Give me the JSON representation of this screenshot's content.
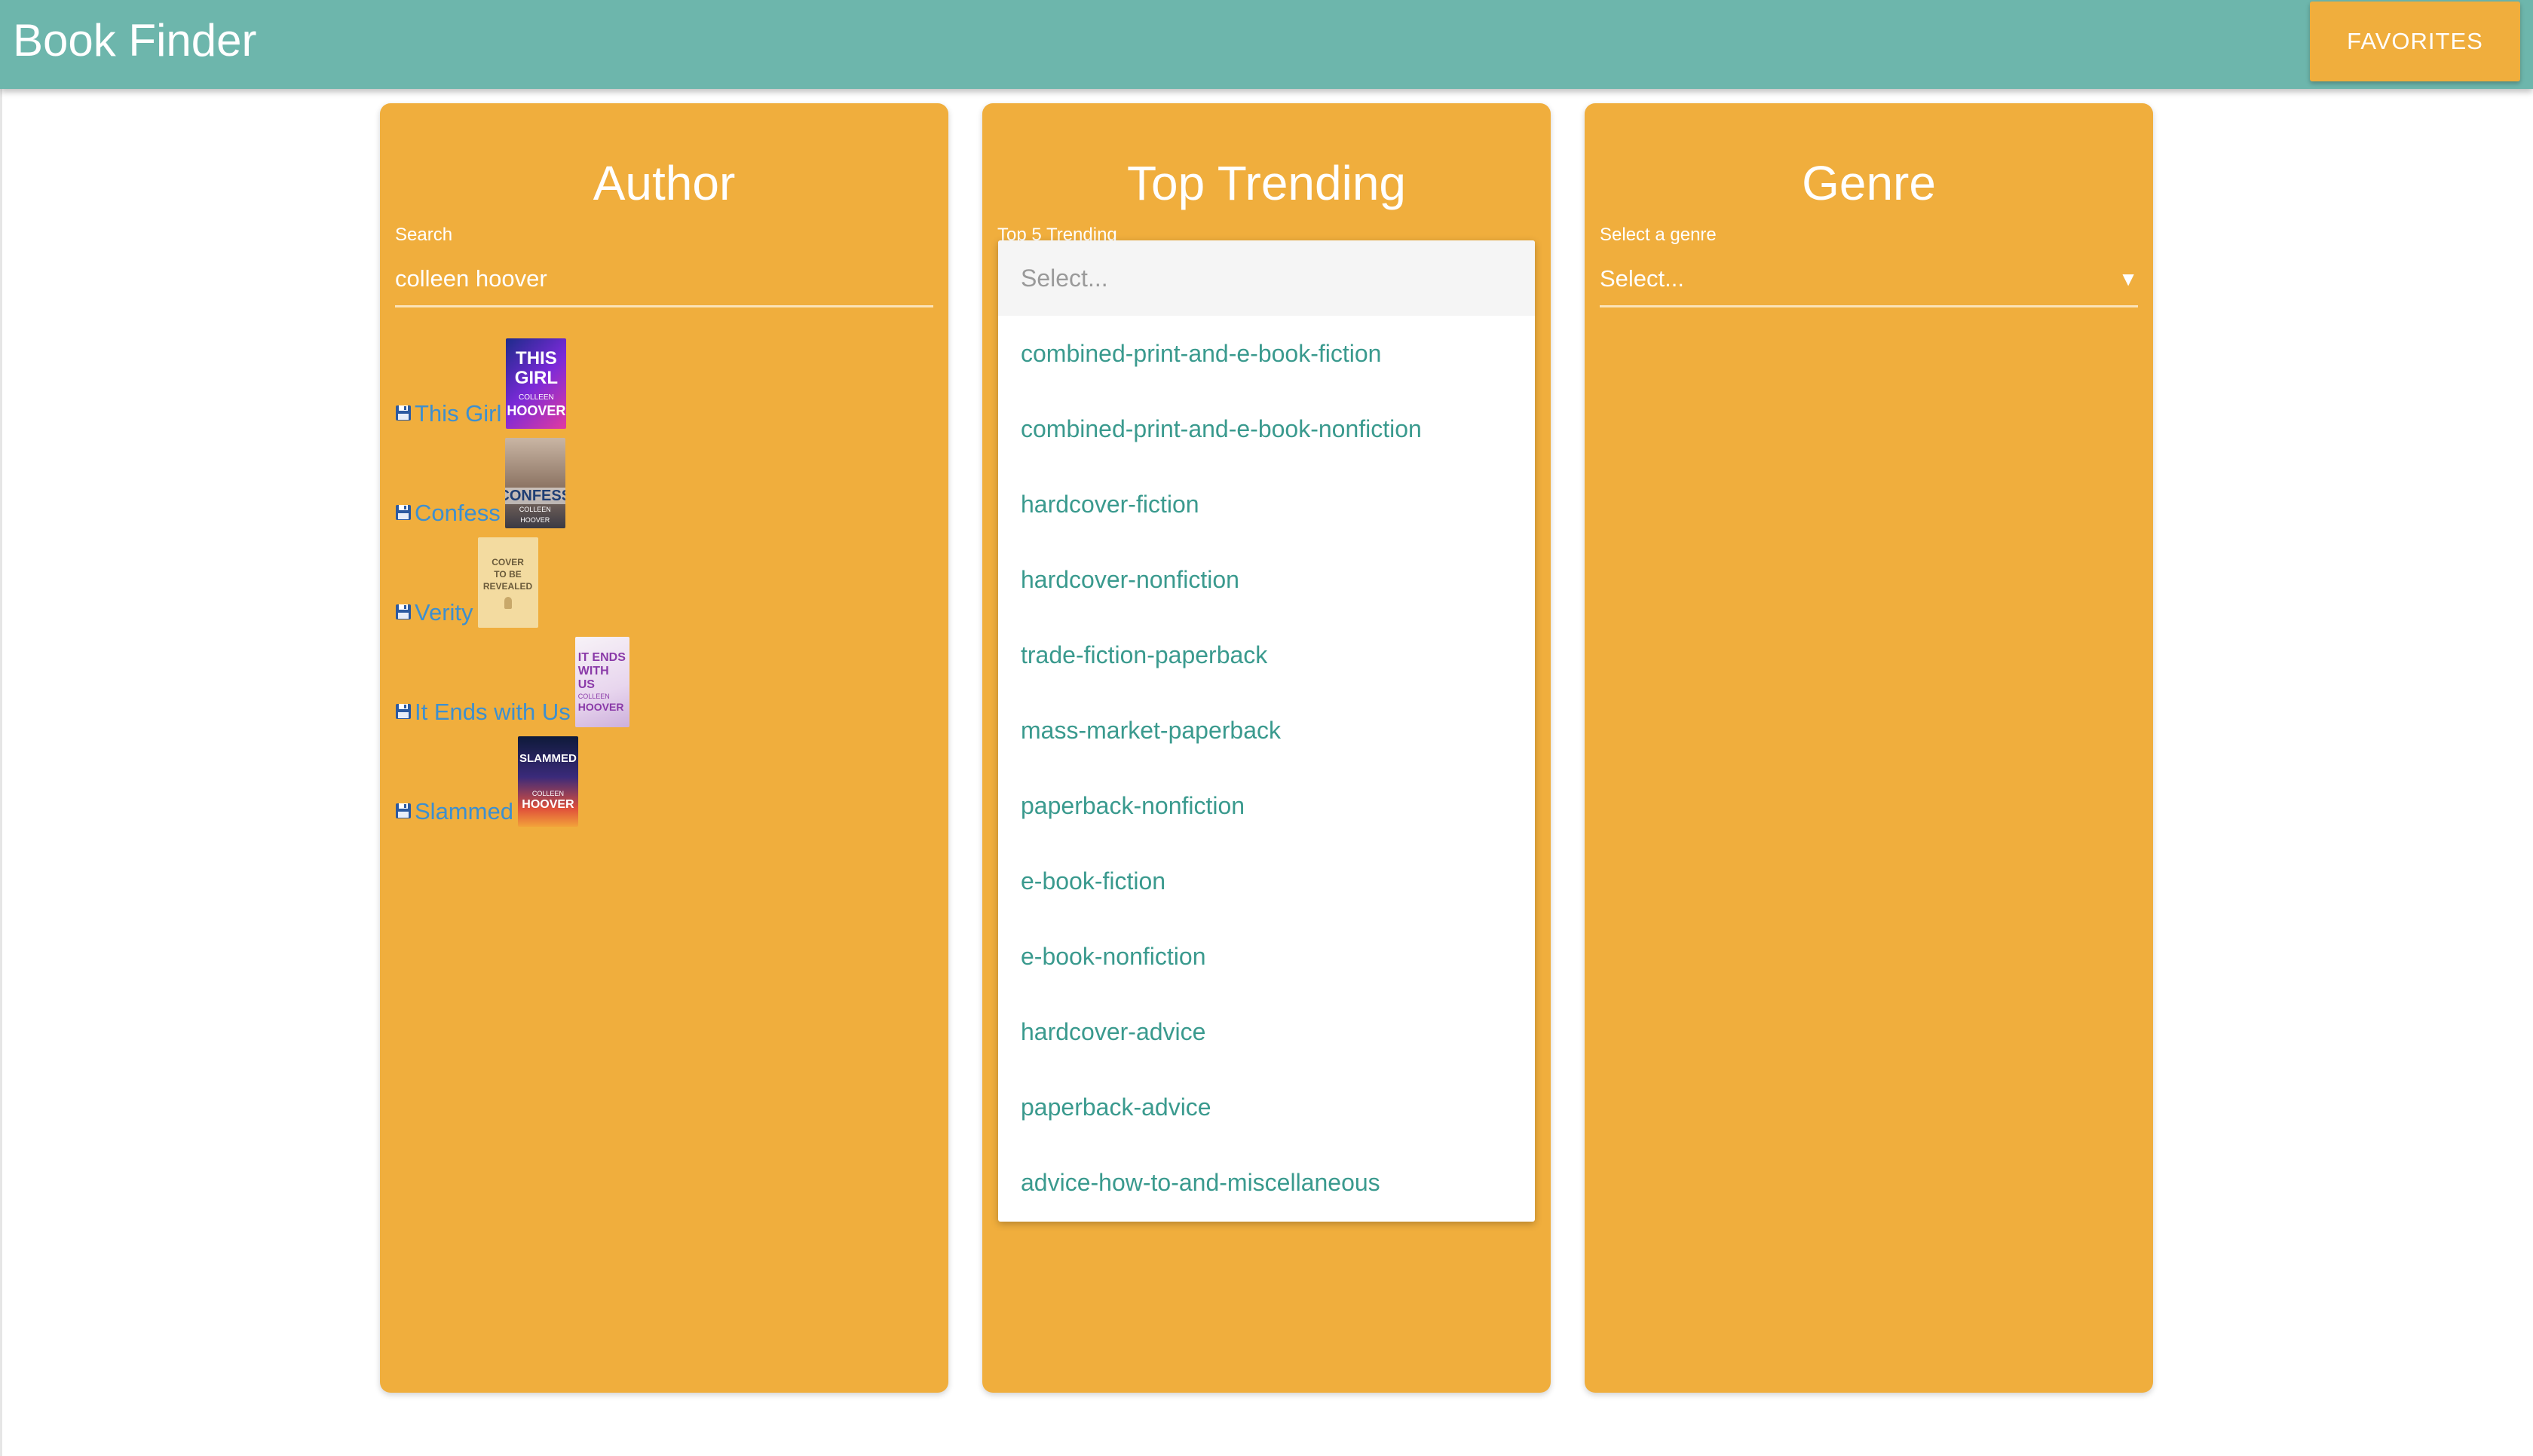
{
  "header": {
    "title": "Book Finder",
    "favorites_label": "FAVORITES"
  },
  "author": {
    "title": "Author",
    "search_label": "Search",
    "search_value": "colleen hoover",
    "books": [
      {
        "title": "This Girl",
        "cover_lines": [
          "THIS",
          "GIRL",
          "COLLEEN",
          "HOOVER"
        ]
      },
      {
        "title": "Confess",
        "cover_lines": [
          "CONFESS",
          "COLLEEN HOOVER"
        ]
      },
      {
        "title": "Verity",
        "cover_lines": [
          "COVER",
          "TO BE",
          "REVEALED"
        ]
      },
      {
        "title": "It Ends with Us",
        "cover_lines": [
          "IT ENDS",
          "WITH",
          "US",
          "COLLEEN",
          "HOOVER"
        ]
      },
      {
        "title": "Slammed",
        "cover_lines": [
          "SLAMMED",
          "COLLEEN",
          "HOOVER"
        ]
      }
    ]
  },
  "trending": {
    "title": "Top Trending",
    "label": "Top 5 Trending",
    "placeholder": "Select...",
    "options": [
      "combined-print-and-e-book-fiction",
      "combined-print-and-e-book-nonfiction",
      "hardcover-fiction",
      "hardcover-nonfiction",
      "trade-fiction-paperback",
      "mass-market-paperback",
      "paperback-nonfiction",
      "e-book-fiction",
      "e-book-nonfiction",
      "hardcover-advice",
      "paperback-advice",
      "advice-how-to-and-miscellaneous"
    ]
  },
  "genre": {
    "title": "Genre",
    "label": "Select a genre",
    "value": "Select...",
    "arrow": "▼"
  },
  "colors": {
    "appbar": "#6db6ac",
    "card": "#f0ae3d",
    "link": "#3d8fcf",
    "option_text": "#3a9a8e"
  }
}
